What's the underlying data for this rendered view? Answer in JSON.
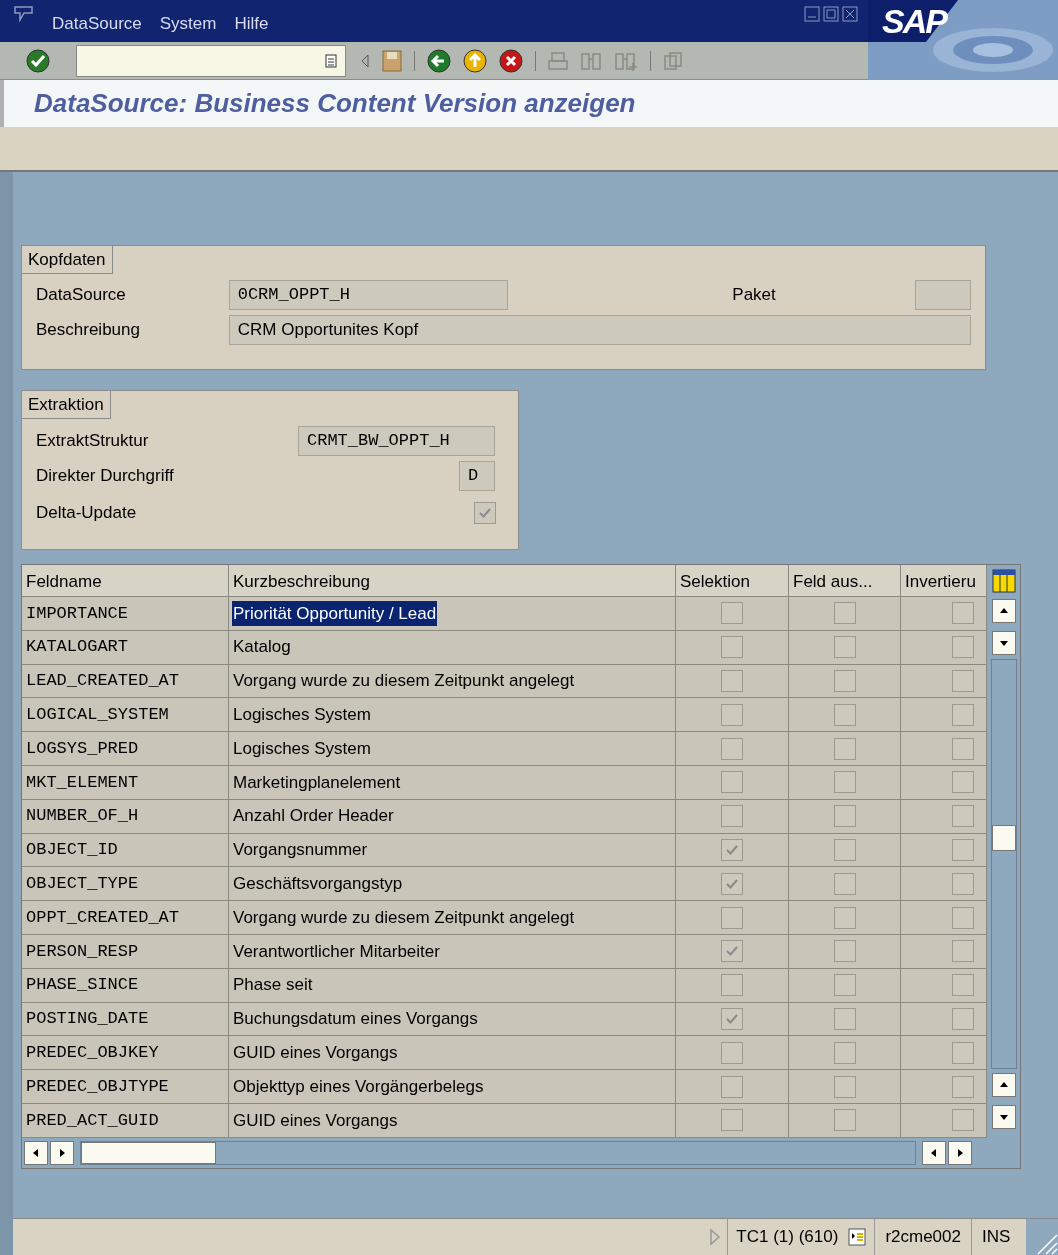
{
  "menu": [
    "DataSource",
    "System",
    "Hilfe"
  ],
  "logo": "SAP",
  "title": "DataSource: Business Content Version anzeigen",
  "kopfdaten": {
    "legend": "Kopfdaten",
    "datasource_label": "DataSource",
    "datasource_value": "0CRM_OPPT_H",
    "paket_label": "Paket",
    "beschreibung_label": "Beschreibung",
    "beschreibung_value": "CRM Opportunites Kopf"
  },
  "extraktion": {
    "legend": "Extraktion",
    "struktur_label": "ExtraktStruktur",
    "struktur_value": "CRMT_BW_OPPT_H",
    "durchgriff_label": "Direkter Durchgriff",
    "durchgriff_value": "D",
    "delta_label": "Delta-Update",
    "delta_checked": true
  },
  "table": {
    "columns": [
      "Feldname",
      "Kurzbeschreibung",
      "Selektion",
      "Feld aus...",
      "Invertieru"
    ],
    "rows": [
      {
        "name": "IMPORTANCE",
        "description": "Priorität Opportunity / Lead",
        "selected": true,
        "selektion": false,
        "feld_aus": false,
        "invertiert": false
      },
      {
        "name": "KATALOGART",
        "description": "Katalog",
        "selected": false,
        "selektion": false,
        "feld_aus": false,
        "invertiert": false
      },
      {
        "name": "LEAD_CREATED_AT",
        "description": "Vorgang wurde zu diesem Zeitpunkt angelegt",
        "selected": false,
        "selektion": false,
        "feld_aus": false,
        "invertiert": false
      },
      {
        "name": "LOGICAL_SYSTEM",
        "description": "Logisches System",
        "selected": false,
        "selektion": false,
        "feld_aus": false,
        "invertiert": false
      },
      {
        "name": "LOGSYS_PRED",
        "description": "Logisches System",
        "selected": false,
        "selektion": false,
        "feld_aus": false,
        "invertiert": false
      },
      {
        "name": "MKT_ELEMENT",
        "description": "Marketingplanelement",
        "selected": false,
        "selektion": false,
        "feld_aus": false,
        "invertiert": false
      },
      {
        "name": "NUMBER_OF_H",
        "description": "Anzahl Order Header",
        "selected": false,
        "selektion": false,
        "feld_aus": false,
        "invertiert": false
      },
      {
        "name": "OBJECT_ID",
        "description": "Vorgangsnummer",
        "selected": false,
        "selektion": true,
        "feld_aus": false,
        "invertiert": false
      },
      {
        "name": "OBJECT_TYPE",
        "description": "Geschäftsvorgangstyp",
        "selected": false,
        "selektion": true,
        "feld_aus": false,
        "invertiert": false
      },
      {
        "name": "OPPT_CREATED_AT",
        "description": "Vorgang wurde zu diesem Zeitpunkt angelegt",
        "selected": false,
        "selektion": false,
        "feld_aus": false,
        "invertiert": false
      },
      {
        "name": "PERSON_RESP",
        "description": "Verantwortlicher Mitarbeiter",
        "selected": false,
        "selektion": true,
        "feld_aus": false,
        "invertiert": false
      },
      {
        "name": "PHASE_SINCE",
        "description": "Phase seit",
        "selected": false,
        "selektion": false,
        "feld_aus": false,
        "invertiert": false
      },
      {
        "name": "POSTING_DATE",
        "description": "Buchungsdatum eines Vorgangs",
        "selected": false,
        "selektion": true,
        "feld_aus": false,
        "invertiert": false
      },
      {
        "name": "PREDEC_OBJKEY",
        "description": "GUID eines Vorgangs",
        "selected": false,
        "selektion": false,
        "feld_aus": false,
        "invertiert": false
      },
      {
        "name": "PREDEC_OBJTYPE",
        "description": "Objekttyp eines Vorgängerbelegs",
        "selected": false,
        "selektion": false,
        "feld_aus": false,
        "invertiert": false
      },
      {
        "name": "PRED_ACT_GUID",
        "description": "GUID eines Vorgangs",
        "selected": false,
        "selektion": false,
        "feld_aus": false,
        "invertiert": false
      }
    ]
  },
  "status_bar": {
    "session": "TC1 (1) (610)",
    "server": "r2cme002",
    "mode": "INS"
  }
}
